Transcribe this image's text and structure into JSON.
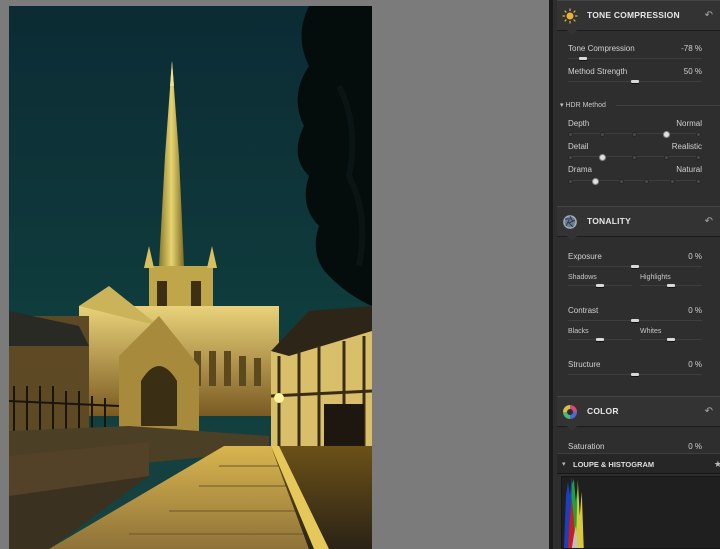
{
  "tone_compression": {
    "title": "TONE COMPRESSION",
    "reset_icon": "undo-icon",
    "icon": "sun-icon",
    "params": [
      {
        "label": "Tone Compression",
        "value": "-78 %",
        "level": 0.11
      },
      {
        "label": "Method Strength",
        "value": "50 %",
        "level": 0.5
      }
    ],
    "hdr_method": {
      "label": "HDR Method",
      "rows": [
        {
          "left": "Depth",
          "right": "Normal",
          "selected": 3,
          "stops": 5
        },
        {
          "left": "Detail",
          "right": "Realistic",
          "selected": 1,
          "stops": 5
        },
        {
          "left": "Drama",
          "right": "Natural",
          "selected": 1,
          "stops": 6
        }
      ]
    }
  },
  "tonality": {
    "title": "TONALITY",
    "icon": "aperture-icon",
    "reset_icon": "undo-icon",
    "exposure": {
      "label": "Exposure",
      "value": "0 %",
      "level": 0.5
    },
    "shadows": {
      "label": "Shadows",
      "level": 0.5
    },
    "highlights": {
      "label": "Highlights",
      "level": 0.5
    },
    "contrast": {
      "label": "Contrast",
      "value": "0 %",
      "level": 0.5
    },
    "blacks": {
      "label": "Blacks",
      "level": 0.5
    },
    "whites": {
      "label": "Whites",
      "level": 0.5
    },
    "structure": {
      "label": "Structure",
      "value": "0 %",
      "level": 0.5
    }
  },
  "color": {
    "title": "COLOR",
    "icon": "color-wheel-icon",
    "reset_icon": "undo-icon",
    "saturation": {
      "label": "Saturation",
      "value": "0 %"
    }
  },
  "loupe": {
    "title": "LOUPE & HISTOGRAM",
    "pin_icon": "pin-icon"
  },
  "colors": {
    "panel_bg": "#2e2e2e",
    "canvas_bg": "#7b7b7b",
    "sky": "#0f3a3c",
    "lights": "#e8c640"
  }
}
